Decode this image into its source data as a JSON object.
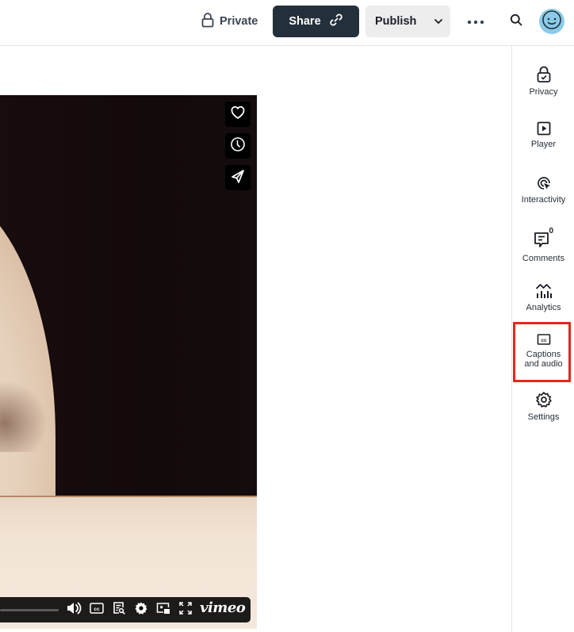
{
  "topbar": {
    "privacy_label": "Private",
    "share_label": "Share",
    "publish_label": "Publish",
    "more_icon": "more-horizontal-icon",
    "search_icon": "search-icon",
    "avatar_icon": "smiley-avatar-icon",
    "avatar_color": "#8ccbe8"
  },
  "rail": {
    "items": [
      {
        "label": "Privacy",
        "icon": "lock-check-icon"
      },
      {
        "label": "Player",
        "icon": "play-square-icon"
      },
      {
        "label": "Interactivity",
        "icon": "cursor-target-icon"
      },
      {
        "label": "Comments",
        "icon": "comment-icon",
        "badge": "0"
      },
      {
        "label": "Analytics",
        "icon": "analytics-icon"
      },
      {
        "label": "Captions\nand audio",
        "label_line1": "Captions",
        "label_line2": "and audio",
        "icon": "cc-icon",
        "highlighted": true
      },
      {
        "label": "Settings",
        "icon": "gear-icon"
      }
    ],
    "highlight_color": "#e8261c"
  },
  "player": {
    "side_actions": [
      {
        "name": "like",
        "icon": "heart-icon"
      },
      {
        "name": "watch-later",
        "icon": "clock-icon"
      },
      {
        "name": "share",
        "icon": "paper-plane-icon"
      }
    ],
    "controls": [
      {
        "name": "volume",
        "icon": "volume-icon"
      },
      {
        "name": "captions",
        "icon": "cc-icon"
      },
      {
        "name": "transcript",
        "icon": "transcript-search-icon"
      },
      {
        "name": "settings",
        "icon": "gear-icon"
      },
      {
        "name": "picture-in-picture",
        "icon": "pip-icon"
      },
      {
        "name": "fullscreen",
        "icon": "fullscreen-icon"
      }
    ],
    "brand": "vimeo"
  },
  "colors": {
    "share_bg": "#23303b",
    "publish_bg": "#ededee",
    "border": "#e3e4ea"
  }
}
